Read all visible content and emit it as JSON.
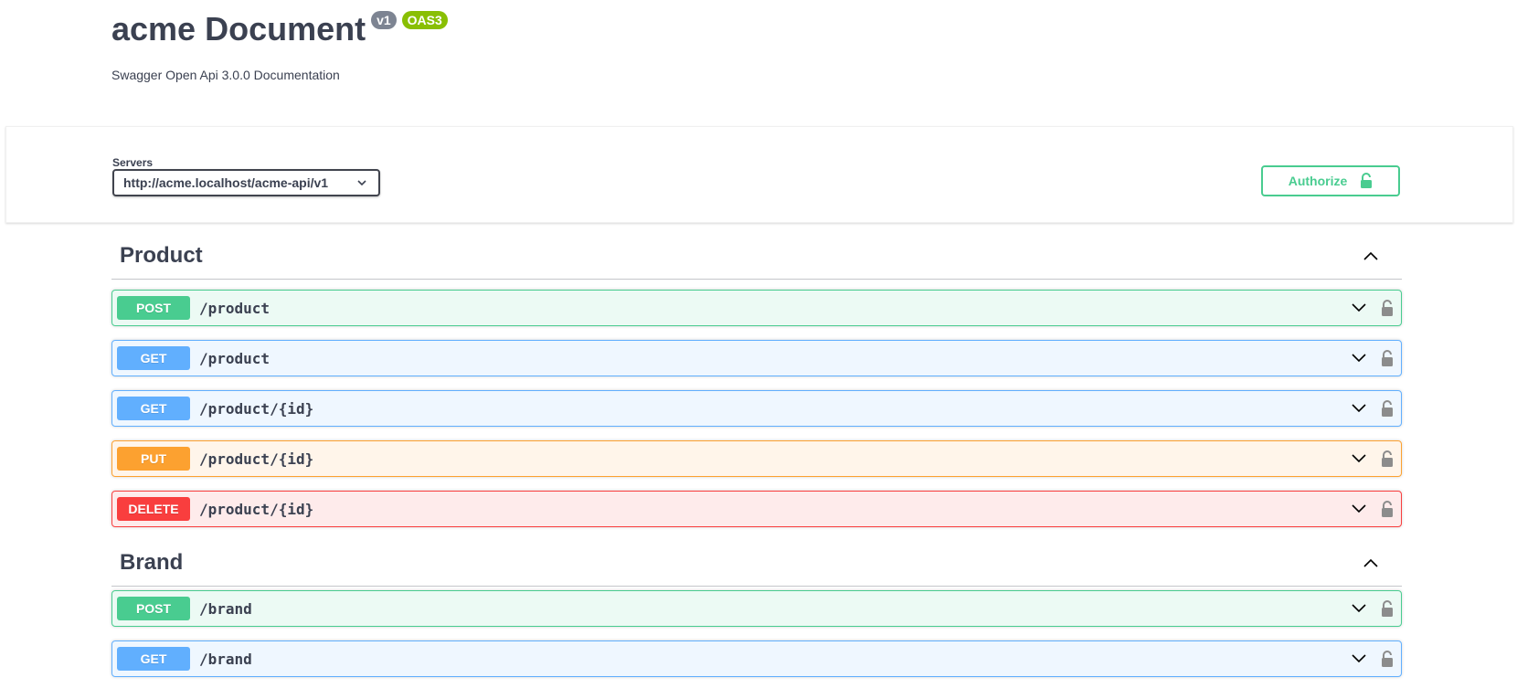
{
  "info": {
    "title": "acme Document",
    "version_badge": "v1",
    "oas_badge": "OAS3",
    "description": "Swagger Open Api 3.0.0 Documentation"
  },
  "servers": {
    "label": "Servers",
    "selected": "http://acme.localhost/acme-api/v1"
  },
  "authorize": {
    "label": "Authorize",
    "icon": "unlock-icon"
  },
  "colors": {
    "post": "#49cc90",
    "get": "#61affe",
    "put": "#fca130",
    "delete": "#f93e3e",
    "text": "#3b4151"
  },
  "tags": [
    {
      "name": "Product",
      "operations": [
        {
          "method": "POST",
          "path": "/product"
        },
        {
          "method": "GET",
          "path": "/product"
        },
        {
          "method": "GET",
          "path": "/product/{id}"
        },
        {
          "method": "PUT",
          "path": "/product/{id}"
        },
        {
          "method": "DELETE",
          "path": "/product/{id}"
        }
      ]
    },
    {
      "name": "Brand",
      "operations": [
        {
          "method": "POST",
          "path": "/brand"
        },
        {
          "method": "GET",
          "path": "/brand"
        }
      ]
    }
  ]
}
